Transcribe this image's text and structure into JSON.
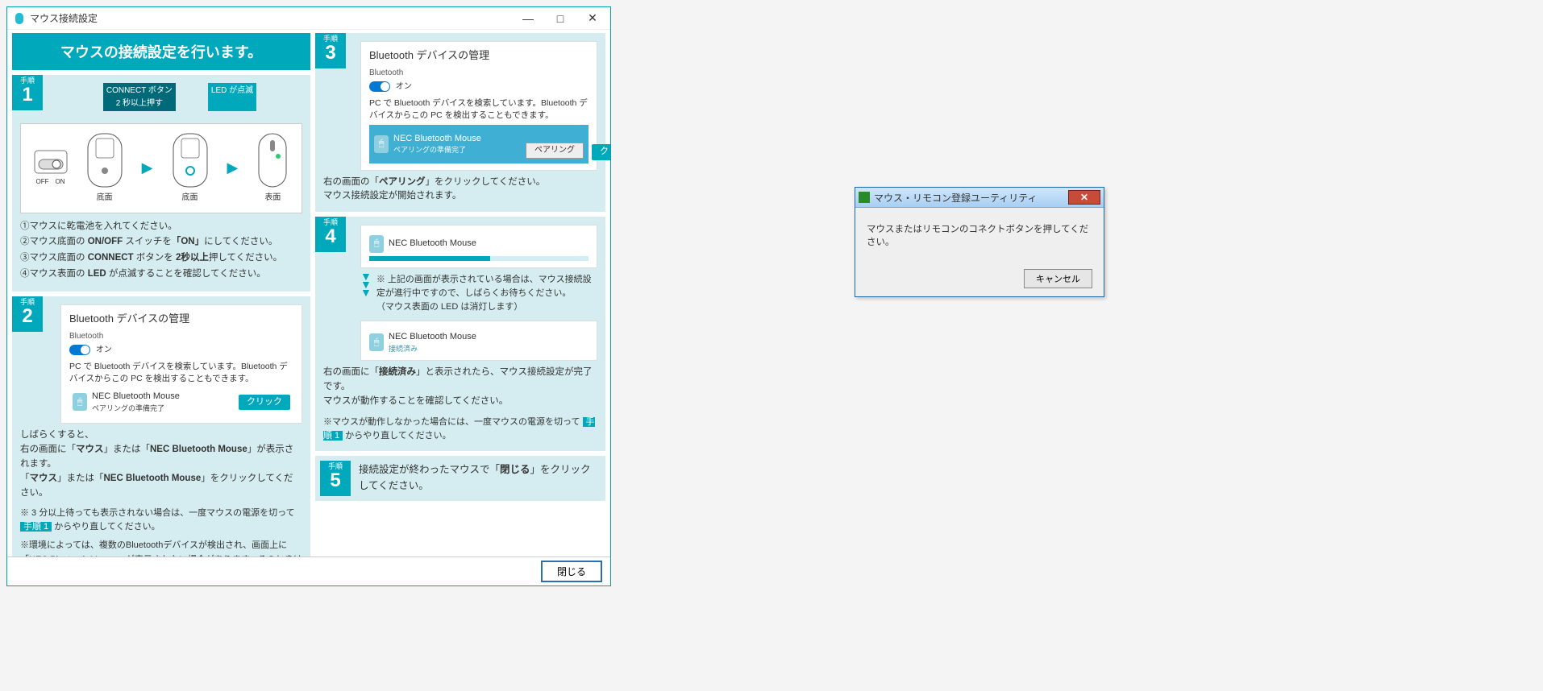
{
  "window": {
    "title": "マウス接続設定",
    "banner": "マウスの接続設定を行います。",
    "close_button": "閉じる"
  },
  "step_label": "手順",
  "click_label": "クリック",
  "on_label": "オン",
  "bluetooth_label": "Bluetooth",
  "bt_manage_title": "Bluetooth デバイスの管理",
  "bt_search_text": "PC で Bluetooth デバイスを検索しています。Bluetooth デバイスからこの PC を検出することもできます。",
  "device_name": "NEC Bluetooth Mouse",
  "pairing_ready": "ペアリングの準備完了",
  "pair_button": "ペアリング",
  "connected": "接続済み",
  "step1": {
    "num": "1",
    "tip_connect": "CONNECT ボタン\n2 秒以上押す",
    "tip_led": "LED が点滅",
    "caption_bottom": "底面",
    "caption_front": "表面",
    "switch_off": "OFF",
    "switch_on": "ON",
    "lines": [
      "①マウスに乾電池を入れてください。",
      "②マウス底面の ON/OFF スイッチを「ON」にしてください。",
      "③マウス底面の CONNECT ボタンを 2秒以上押してください。",
      "④マウス表面の LED が点滅することを確認してください。"
    ]
  },
  "step2": {
    "num": "2",
    "after_wait": "しばらくすると、",
    "line1_a": "右の画面に「",
    "line1_b": "マウス",
    "line1_c": "」または「",
    "line1_d": "NEC Bluetooth Mouse",
    "line1_e": "」が表示されます。",
    "line2_a": "「",
    "line2_b": "マウス",
    "line2_c": "」または「",
    "line2_d": "NEC Bluetooth Mouse",
    "line2_e": "」をクリックしてください。",
    "note1_a": "※ 3 分以上待っても表示されない場合は、一度マウスの電源を切って ",
    "note1_b": "手順 1",
    "note1_c": " からやり直してください。",
    "note2": "※環境によっては、複数のBluetoothデバイスが検出され、画面上に「NEC Bluetooth Mouse」が表示されない場合があります。そのときは「NEC Bluetooth Mouse」が表示されるまで、画面を上下にスクロールさせてください。"
  },
  "step3": {
    "num": "3",
    "line1_a": "右の画面の「",
    "line1_b": "ペアリング",
    "line1_c": "」をクリックしてください。",
    "line2": "マウス接続設定が開始されます。"
  },
  "step4": {
    "num": "4",
    "mid1": "※ 上記の画面が表示されている場合は、マウス接続設定が進行中ですので、しばらくお待ちください。",
    "mid2": "（マウス表面の LED は消灯します）",
    "fin_a": "右の画面に「",
    "fin_b": "接続済み",
    "fin_c": "」と表示されたら、マウス接続設定が完了です。",
    "fin2": "マウスが動作することを確認してください。",
    "note_a": "※マウスが動作しなかった場合には、一度マウスの電源を切って ",
    "note_b": "手順 1",
    "note_c": " からやり直してください。"
  },
  "step5": {
    "num": "5",
    "text_a": "接続設定が終わったマウスで「",
    "text_b": "閉じる",
    "text_c": "」をクリックしてください。"
  },
  "dialog": {
    "title": "マウス・リモコン登録ユーティリティ",
    "body": "マウスまたはリモコンのコネクトボタンを押してください。",
    "cancel": "キャンセル"
  }
}
